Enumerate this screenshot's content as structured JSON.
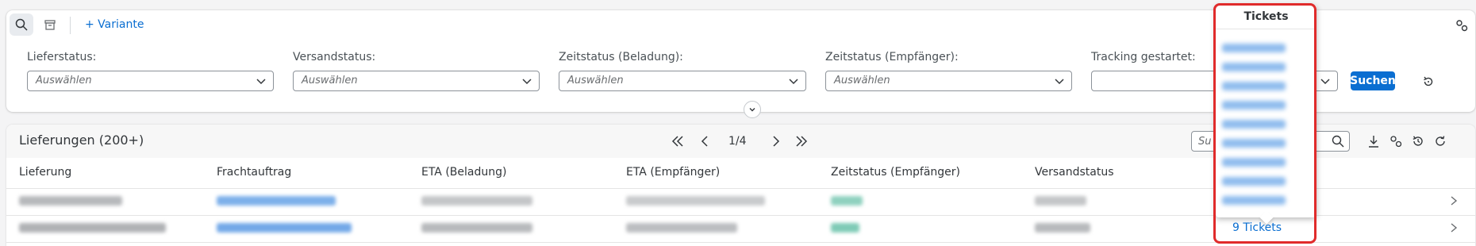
{
  "filterbar": {
    "variant_label": "+ Variante",
    "fields": [
      {
        "label": "Lieferstatus:",
        "placeholder": "Auswählen"
      },
      {
        "label": "Versandstatus:",
        "placeholder": "Auswählen"
      },
      {
        "label": "Zeitstatus (Beladung):",
        "placeholder": "Auswählen"
      },
      {
        "label": "Zeitstatus (Empfänger):",
        "placeholder": "Auswählen"
      },
      {
        "label": "Tracking gestartet:",
        "placeholder": ""
      }
    ],
    "search_button": "Suchen"
  },
  "table": {
    "title": "Lieferungen (200+)",
    "page": "1/4",
    "search_placeholder": "Su",
    "columns": [
      "Lieferung",
      "Frachtauftrag",
      "ETA (Beladung)",
      "ETA (Empfänger)",
      "Zeitstatus (Empfänger)",
      "Versandstatus"
    ],
    "tickets_link": "9 Tickets"
  },
  "popover": {
    "title": "Tickets"
  },
  "colors": {
    "accent": "#0a6ed1",
    "highlight": "#e02b2b"
  }
}
